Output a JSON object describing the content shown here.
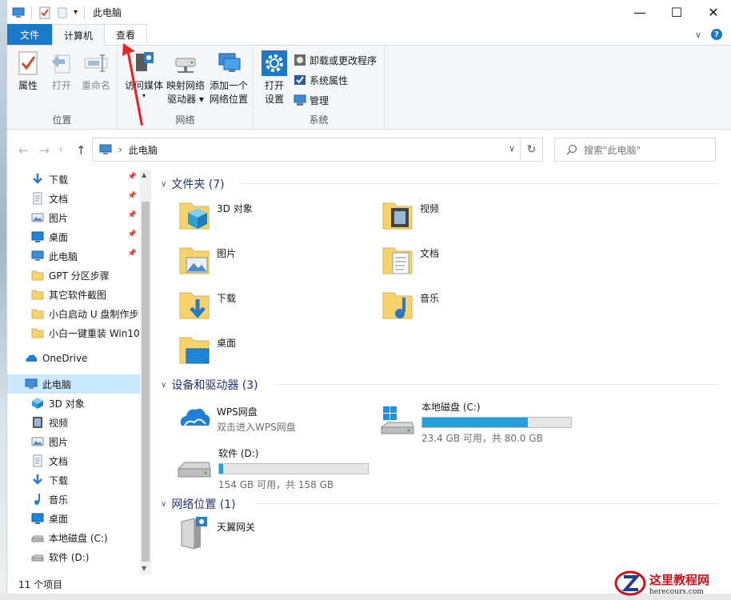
{
  "window": {
    "title": "此电脑"
  },
  "tabs": {
    "file": "文件",
    "computer": "计算机",
    "view": "查看"
  },
  "ribbon": {
    "location": {
      "label": "位置",
      "properties": "属性",
      "open": "打开",
      "rename": "重命名"
    },
    "network": {
      "label": "网络",
      "media_line1": "访问媒体",
      "map_line1": "映射网络",
      "map_line2": "驱动器",
      "add_line1": "添加一个",
      "add_line2": "网络位置"
    },
    "system": {
      "label": "系统",
      "open_line1": "打开",
      "open_line2": "设置",
      "uninstall": "卸载或更改程序",
      "sys_props": "系统属性",
      "manage": "管理"
    }
  },
  "address": {
    "path": "此电脑",
    "search_placeholder": "搜索\"此电脑\""
  },
  "nav": {
    "quick": [
      {
        "label": "下载",
        "icon": "download-icon"
      },
      {
        "label": "文档",
        "icon": "document-icon"
      },
      {
        "label": "图片",
        "icon": "picture-icon"
      },
      {
        "label": "桌面",
        "icon": "desktop-icon"
      },
      {
        "label": "此电脑",
        "icon": "computer-icon"
      },
      {
        "label": "GPT 分区步骤",
        "icon": "folder-icon"
      },
      {
        "label": "其它软件截图",
        "icon": "folder-icon"
      },
      {
        "label": "小白启动 U 盘制作步",
        "icon": "folder-icon"
      },
      {
        "label": "小白一键重装 Win10",
        "icon": "folder-icon"
      }
    ],
    "onedrive": "OneDrive",
    "thispc": "此电脑",
    "pc_items": [
      {
        "label": "3D 对象",
        "icon": "3d-object-icon"
      },
      {
        "label": "视频",
        "icon": "video-icon"
      },
      {
        "label": "图片",
        "icon": "picture-icon"
      },
      {
        "label": "文档",
        "icon": "document-icon"
      },
      {
        "label": "下载",
        "icon": "download-icon"
      },
      {
        "label": "音乐",
        "icon": "music-icon"
      },
      {
        "label": "桌面",
        "icon": "desktop-icon"
      },
      {
        "label": "本地磁盘 (C:)",
        "icon": "drive-icon"
      },
      {
        "label": "软件 (D:)",
        "icon": "drive-icon"
      }
    ]
  },
  "content": {
    "folders_head": "文件夹 (7)",
    "folders": [
      {
        "label": "3D 对象"
      },
      {
        "label": "视频"
      },
      {
        "label": "图片"
      },
      {
        "label": "文档"
      },
      {
        "label": "下载"
      },
      {
        "label": "音乐"
      },
      {
        "label": "桌面"
      }
    ],
    "devices_head": "设备和驱动器 (3)",
    "wps": {
      "name": "WPS网盘",
      "sub": "双击进入WPS网盘"
    },
    "drive_c": {
      "name": "本地磁盘 (C:)",
      "sub": "23.4 GB 可用，共 80.0 GB",
      "used_fraction": 0.7075
    },
    "drive_d": {
      "name": "软件 (D:)",
      "sub": "154 GB 可用，共 158 GB",
      "used_fraction": 0.0253
    },
    "network_head": "网络位置 (1)",
    "gateway": {
      "name": "天翼网关"
    }
  },
  "status": {
    "items": "11 个项目"
  },
  "watermark": {
    "main": "这里教程网",
    "sub": "herecours.com"
  },
  "colors": {
    "accent": "#1979ca",
    "drive_fill": "#26a0da",
    "selection": "#cce8ff",
    "annotation": "#e8262a"
  }
}
